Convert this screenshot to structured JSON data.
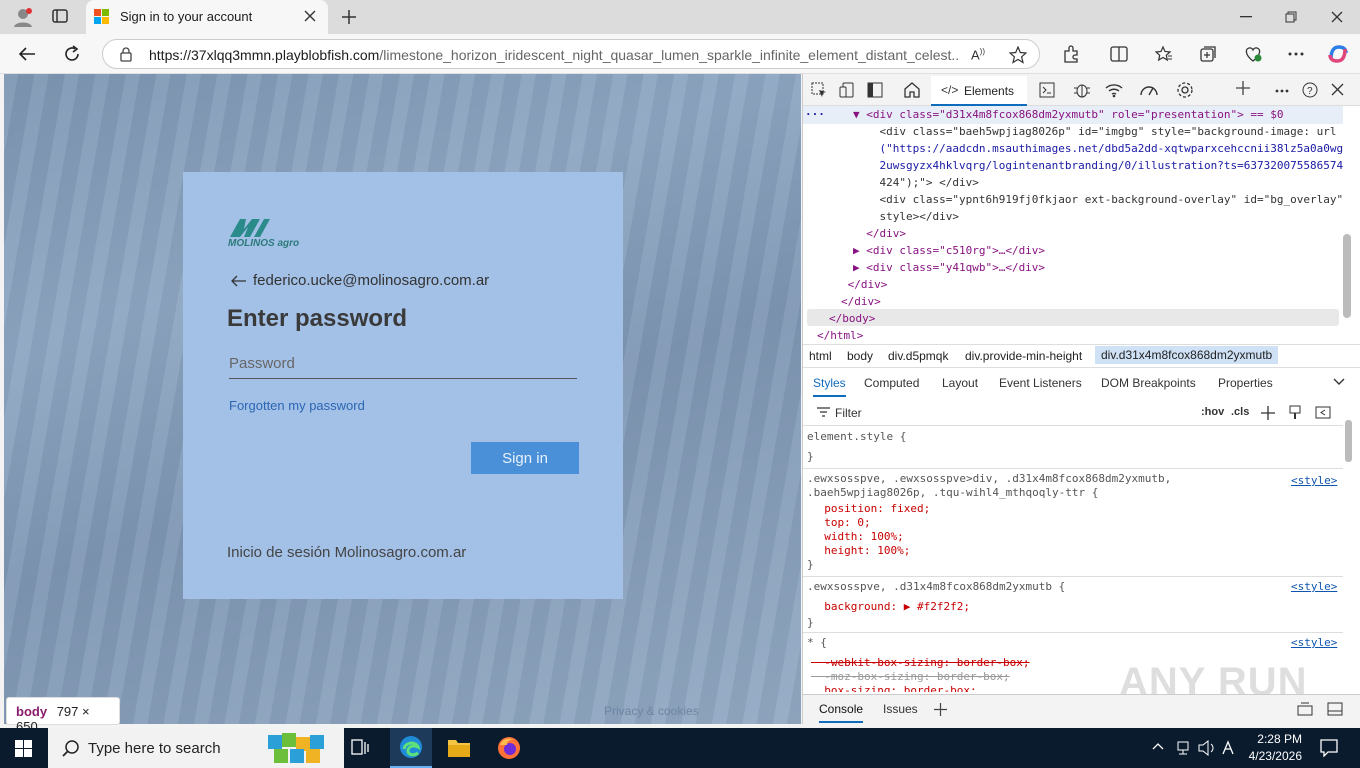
{
  "browser": {
    "tab_title": "Sign in to your account",
    "url_host": "https://37xlqq3mmn.playblobfish.com",
    "url_path": "/limestone_horizon_iridescent_night_quasar_lumen_sparkle_infinite_element_distant_celest..."
  },
  "page": {
    "logo_text": "MOLINOS agro",
    "email": "federico.ucke@molinosagro.com.ar",
    "heading": "Enter password",
    "password_placeholder": "Password",
    "forgot_link": "Forgotten my password",
    "signin_button": "Sign in",
    "footer_text": "Inicio de sesión Molinosagro.com.ar",
    "page_footer": "Privacy & cookies",
    "tooltip_tag": "body",
    "tooltip_size": "797 × 650"
  },
  "devtools": {
    "elements_tab": "Elements",
    "dom": [
      "▼ <div class=\"d31x4m8fcox868dm2yxmutb\" role=\"presentation\"> == $0",
      "    <div class=\"baeh5wpjiag8026p\" id=\"imgbg\" style=\"background-image: url",
      "    (\"https://aadcdn.msauthimages.net/dbd5a2dd-xqtwparxcehccnii38lz5a0a0wg",
      "    2uwsgyzx4hklvqrg/logintenantbranding/0/illustration?ts=637320075586574",
      "    424\");\"> </div>",
      "    <div class=\"ypnt6h919fj0fkjaor ext-background-overlay\" id=\"bg_overlay\"",
      "    style></div>",
      "  </div>",
      "▶ <div class=\"c510rg\">…</div>",
      "▶ <div class=\"y41qwb\">…</div>",
      " </div>",
      "</div>",
      "</body>",
      "</html>"
    ],
    "breadcrumbs": [
      "html",
      "body",
      "div.d5pmqk",
      "div.provide-min-height",
      "div.d31x4m8fcox868dm2yxmutb"
    ],
    "style_tabs": [
      "Styles",
      "Computed",
      "Layout",
      "Event Listeners",
      "DOM Breakpoints",
      "Properties"
    ],
    "filter_placeholder": "Filter",
    "filter_tools": [
      ":hov",
      ".cls"
    ],
    "rules": [
      "element.style {",
      "}",
      ".ewxsosspve, .ewxsosspve>div, .d31x4m8fcox868dm2yxmutb,",
      ".baeh5wpjiag8026p, .tqu-wihl4_mthqoqly-ttr {",
      "  position: fixed;",
      "  top: 0;",
      "  width: 100%;",
      "  height: 100%;",
      "}",
      ".ewxsosspve, .d31x4m8fcox868dm2yxmutb {",
      "  background: ▶ #f2f2f2;",
      "}",
      "* {",
      "  -webkit-box-sizing: border-box;",
      "  -moz-box-sizing: border-box;",
      "  box-sizing: border-box;"
    ],
    "style_source": "<style>",
    "drawer_tabs": [
      "Console",
      "Issues"
    ],
    "watermark": "ANY RUN"
  },
  "taskbar": {
    "search_placeholder": "Type here to search",
    "time": "2:28 PM",
    "date": "4/23/2026"
  }
}
